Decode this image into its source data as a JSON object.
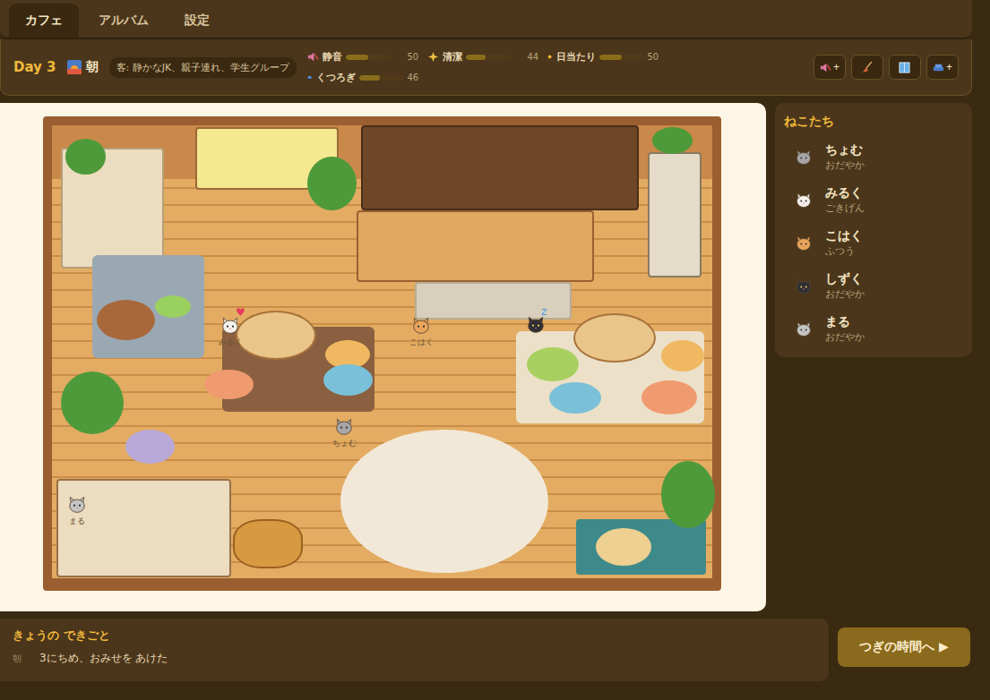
{
  "tabs": [
    {
      "label": "カフェ",
      "selected": true
    },
    {
      "label": "アルバム",
      "selected": false
    },
    {
      "label": "設定",
      "selected": false
    }
  ],
  "status": {
    "day": "Day 3",
    "time": "朝",
    "guests": "客: 静かなJK、親子連れ、学生グループ",
    "stats": [
      {
        "kind": "quiet",
        "label": "静音",
        "value": "50",
        "level": 0.5
      },
      {
        "kind": "clean",
        "label": "清潔",
        "value": "44",
        "level": 0.44
      },
      {
        "kind": "sun",
        "label": "日当たり",
        "value": "50",
        "level": 0.5
      },
      {
        "kind": "relax",
        "label": "くつろぎ",
        "value": "46",
        "level": 0.46
      }
    ],
    "buttons": [
      {
        "kind": "quiet",
        "mark": "+"
      },
      {
        "kind": "clean"
      },
      {
        "kind": "window"
      },
      {
        "kind": "sofa",
        "mark": "+"
      }
    ]
  },
  "scene": {
    "cats": [
      {
        "label": "みるく",
        "color": "#f4f1ea",
        "heart": true,
        "sleeping": false
      },
      {
        "label": "こはく",
        "color": "#e9a55a",
        "heart": false,
        "sleeping": false
      },
      {
        "color": "#2e2e34",
        "heart": false,
        "sleeping": true
      },
      {
        "label": "ちょむ",
        "color": "#a7a7a7",
        "heart": false,
        "sleeping": false
      },
      {
        "label": "まる",
        "color": "#c4c4c4",
        "heart": false,
        "sleeping": false
      }
    ]
  },
  "sidebar": {
    "title": "ねこたち",
    "cats": [
      {
        "name": "ちょむ",
        "mood": "おだやか",
        "color": "#a7a7a7"
      },
      {
        "name": "みるく",
        "mood": "ごきげん",
        "color": "#f4f1ea"
      },
      {
        "name": "こはく",
        "mood": "ふつう",
        "color": "#e9a55a"
      },
      {
        "name": "しずく",
        "mood": "おだやか",
        "color": "#2e2e34"
      },
      {
        "name": "まる",
        "mood": "おだやか",
        "color": "#c4c4c4"
      }
    ]
  },
  "log": {
    "title": "きょうの できごと",
    "entries": [
      {
        "time": "朝",
        "text": "3にちめ、おみせを あけた"
      }
    ]
  },
  "next_button": {
    "label": "つぎの時間へ ▶"
  }
}
